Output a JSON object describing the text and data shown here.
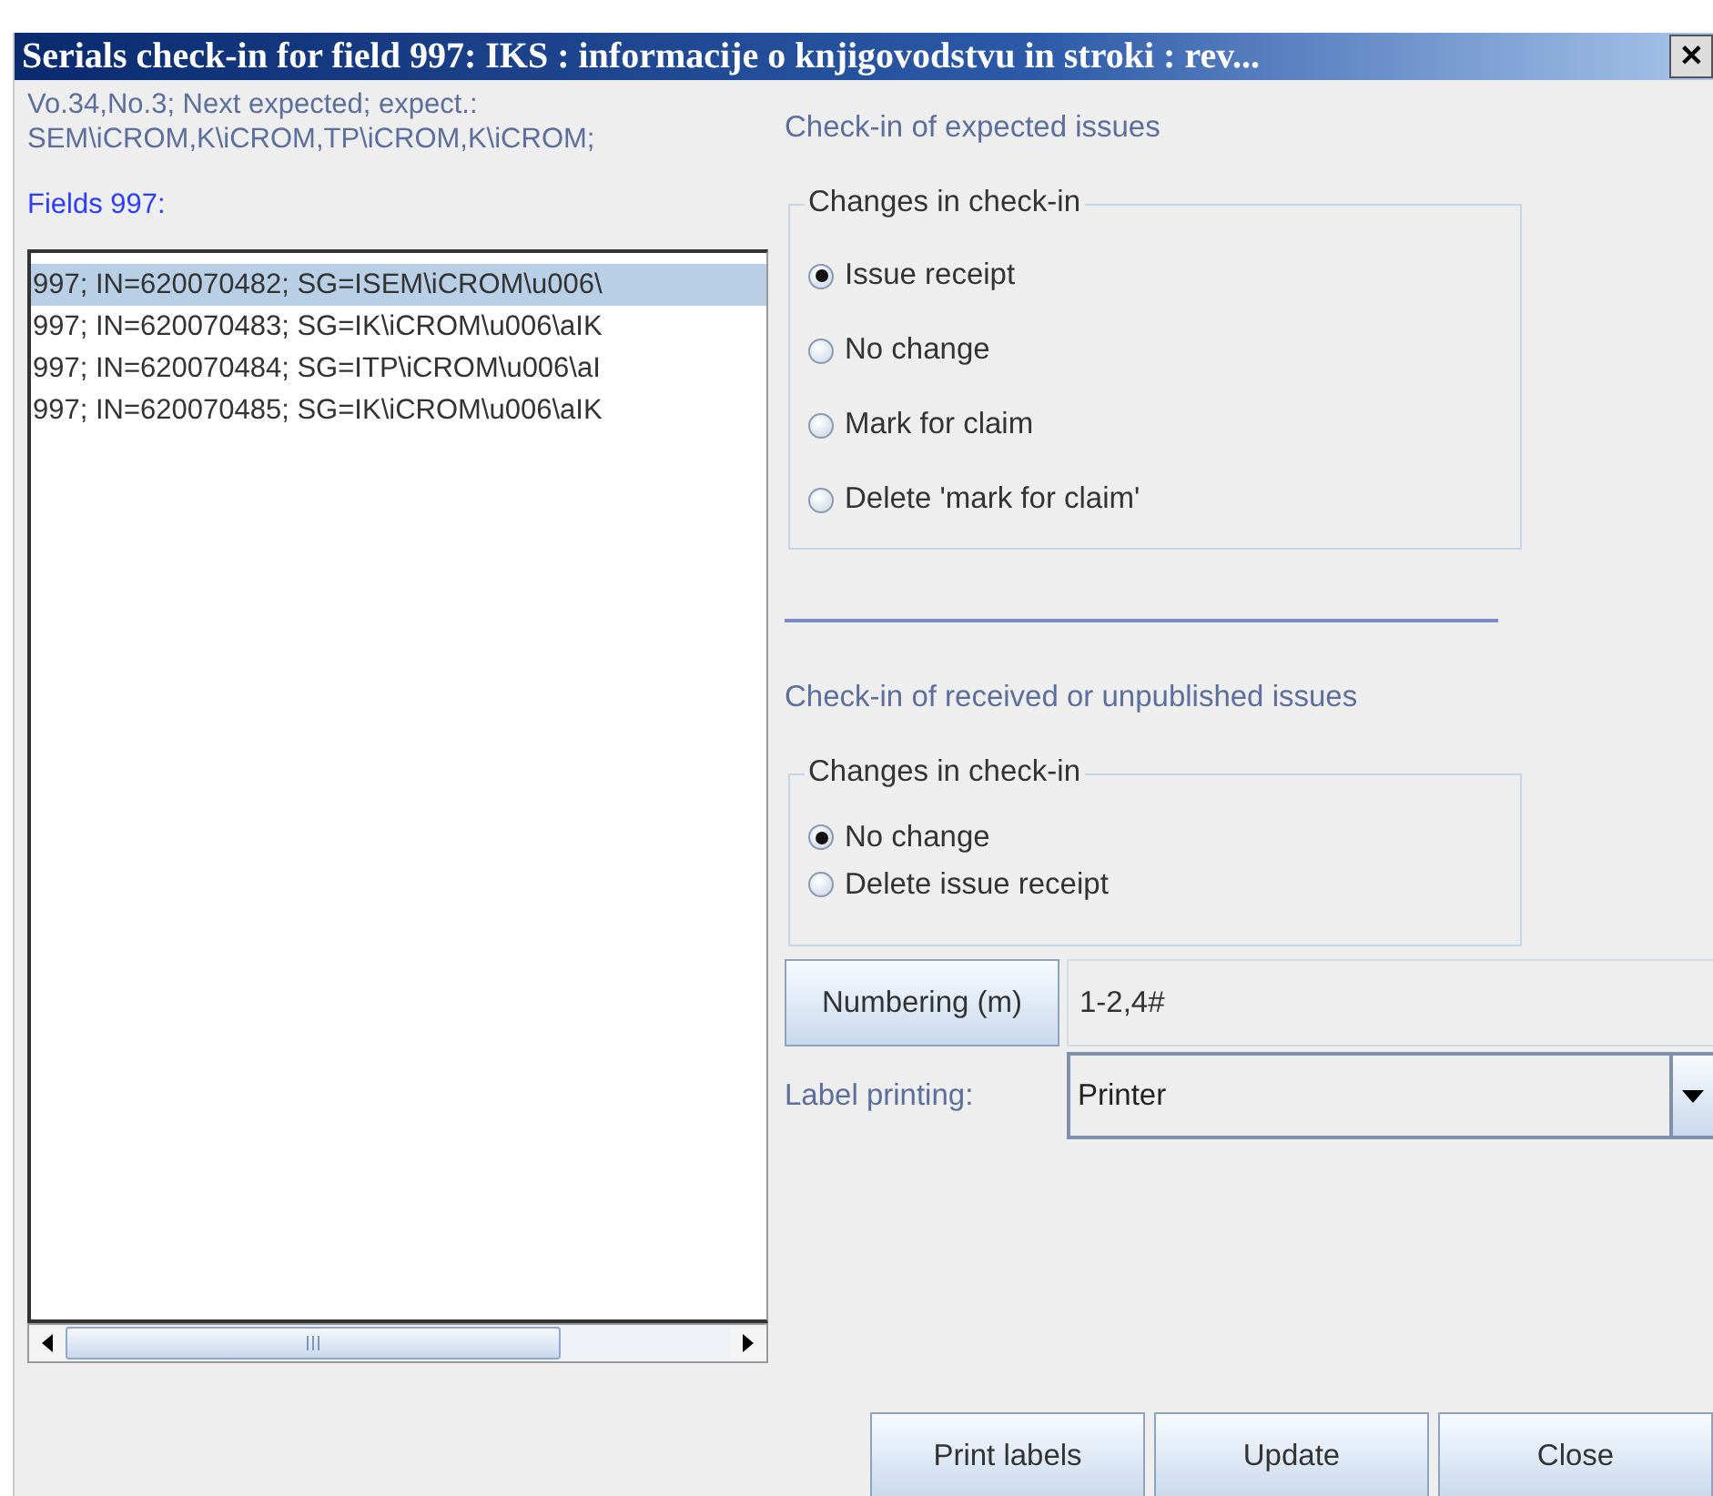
{
  "window": {
    "title": "Serials check-in for field 997: IKS : informacije o knjigovodstvu in stroki : rev...",
    "close": "✕"
  },
  "info_lines": [
    "Vo.34,No.3; Next expected; expect.:",
    "SEM\\iCROM,K\\iCROM,TP\\iCROM,K\\iCROM;"
  ],
  "fields_label": "Fields 997:",
  "fields": [
    {
      "text": "997; IN=620070482; SG=ISEM\\iCROM\\u006\\",
      "selected": true
    },
    {
      "text": "997; IN=620070483; SG=IK\\iCROM\\u006\\aIK",
      "selected": false
    },
    {
      "text": "997; IN=620070484; SG=ITP\\iCROM\\u006\\aI",
      "selected": false
    },
    {
      "text": "997; IN=620070485; SG=IK\\iCROM\\u006\\aIK",
      "selected": false
    }
  ],
  "expected": {
    "heading": "Check-in of expected issues",
    "group": "Changes in check-in",
    "options": [
      {
        "label": "Issue receipt",
        "selected": true
      },
      {
        "label": "No change",
        "selected": false
      },
      {
        "label": "Mark for claim",
        "selected": false
      },
      {
        "label": "Delete 'mark for claim'",
        "selected": false
      }
    ]
  },
  "received": {
    "heading": "Check-in of received or unpublished issues",
    "group": "Changes in check-in",
    "options": [
      {
        "label": "No change",
        "selected": true
      },
      {
        "label": "Delete issue receipt",
        "selected": false
      }
    ]
  },
  "numbering": {
    "button": "Numbering (m)",
    "value": "1-2,4#"
  },
  "label_printing": {
    "label": "Label printing:",
    "value": "Printer"
  },
  "buttons": [
    "Print labels",
    "Update",
    "Close"
  ]
}
